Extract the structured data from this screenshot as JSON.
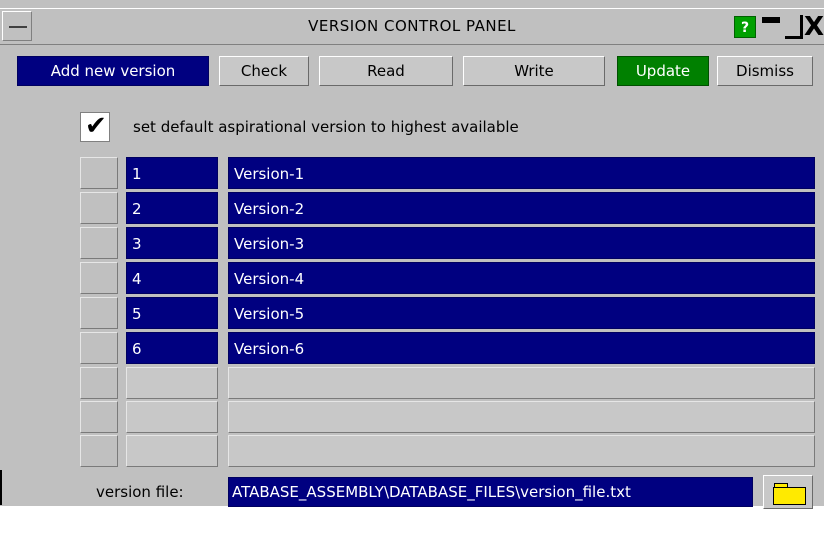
{
  "window": {
    "title": "VERSION CONTROL PANEL",
    "help_label": "?",
    "close_glyph": "X"
  },
  "toolbar": {
    "add_new_version": "Add new version",
    "check": "Check",
    "read": "Read",
    "write": "Write",
    "update": "Update",
    "dismiss": "Dismiss"
  },
  "options": {
    "default_highest_checked": true,
    "default_highest_label": "set default aspirational version to highest available",
    "check_glyph": "✔"
  },
  "versions": [
    {
      "num": "1",
      "name": "Version-1"
    },
    {
      "num": "2",
      "name": "Version-2"
    },
    {
      "num": "3",
      "name": "Version-3"
    },
    {
      "num": "4",
      "name": "Version-4"
    },
    {
      "num": "5",
      "name": "Version-5"
    },
    {
      "num": "6",
      "name": "Version-6"
    }
  ],
  "version_file": {
    "label": "version file:",
    "value": "ATABASE_ASSEMBLY\\DATABASE_FILES\\version_file.txt"
  },
  "icons": {
    "folder": "folder-icon",
    "system_menu": "system-menu-icon",
    "minimize": "minimize-icon",
    "maximize": "maximize-icon",
    "close": "close-icon",
    "help": "help-icon"
  },
  "colors": {
    "panel_bg": "#c0c0c0",
    "selection_blue": "#000080",
    "update_green": "#008000",
    "help_green": "#00a000",
    "folder_yellow": "#ffea00"
  }
}
